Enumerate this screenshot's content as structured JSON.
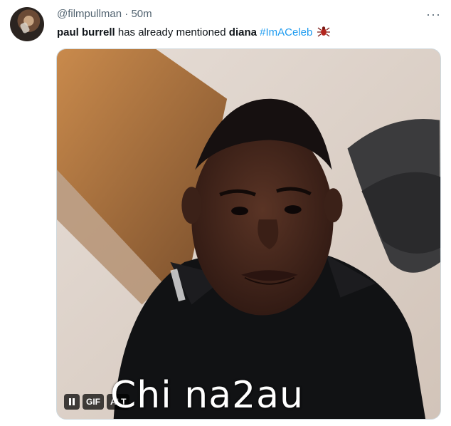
{
  "tweet": {
    "handle": "@filmpullman",
    "separator": "·",
    "time": "50m",
    "more_label": "···",
    "text": {
      "part1": "paul burrell",
      "part2": " has already mentioned ",
      "part3": "diana",
      "part4": " ",
      "hashtag": "#ImACeleb"
    },
    "hashtag_color": "#1d9bf0"
  },
  "media": {
    "controls": {
      "gif": "GIF",
      "alt": "ALT"
    }
  },
  "watermark": "Chi na2au"
}
